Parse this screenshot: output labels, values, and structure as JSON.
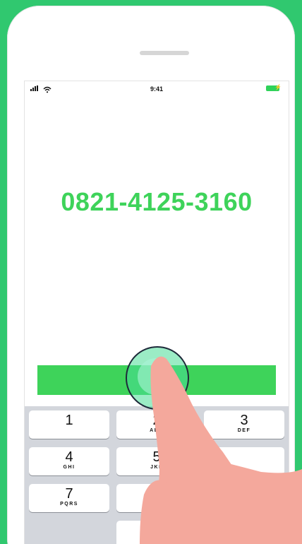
{
  "status_bar": {
    "time": "9:41",
    "signal_icon": "signal-bars-icon",
    "wifi_icon": "wifi-icon",
    "battery_icon": "battery-charging-icon"
  },
  "dialer": {
    "number": "0821-4125-3160",
    "call_bar_color": "#3ed35a"
  },
  "keypad": {
    "keys": [
      {
        "digit": "1",
        "letters": ""
      },
      {
        "digit": "2",
        "letters": "ABC"
      },
      {
        "digit": "3",
        "letters": "DEF"
      },
      {
        "digit": "4",
        "letters": "GHI"
      },
      {
        "digit": "5",
        "letters": "JKL"
      },
      {
        "digit": "",
        "letters": ""
      },
      {
        "digit": "7",
        "letters": "PQRS"
      },
      {
        "digit": "",
        "letters": ""
      },
      {
        "digit": "",
        "letters": ""
      },
      {
        "digit": "",
        "letters": ""
      },
      {
        "digit": "",
        "letters": ""
      },
      {
        "digit": "",
        "letters": ""
      }
    ]
  },
  "colors": {
    "background": "#30c86f",
    "accent": "#3ed35a",
    "finger": "#f4a89c"
  }
}
